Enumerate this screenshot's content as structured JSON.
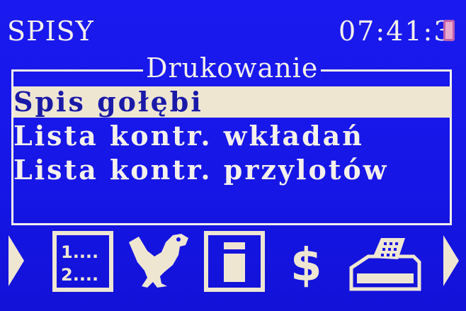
{
  "header": {
    "app_title": "SPISY",
    "clock": "07:41:3"
  },
  "menu": {
    "title": "Drukowanie",
    "items": [
      {
        "label": "Spis gołębi",
        "selected": true
      },
      {
        "label": "Lista kontr. wkładań",
        "selected": false
      },
      {
        "label": "Lista kontr. przylotów",
        "selected": false
      }
    ]
  },
  "toolbar": {
    "icons": [
      "arrow-left-icon",
      "numbered-list-icon",
      "pigeon-icon",
      "document-icon",
      "dollar-icon",
      "printer-icon",
      "arrow-right-icon"
    ],
    "list_line_1": "1....",
    "list_line_2": "2....",
    "dollar_symbol": "$"
  },
  "colors": {
    "background": "#1717e8",
    "foreground": "#f4f0ea",
    "highlight": "#efe6d2",
    "highlight_text": "#1a1aa8",
    "battery": "#e8a8d0"
  }
}
